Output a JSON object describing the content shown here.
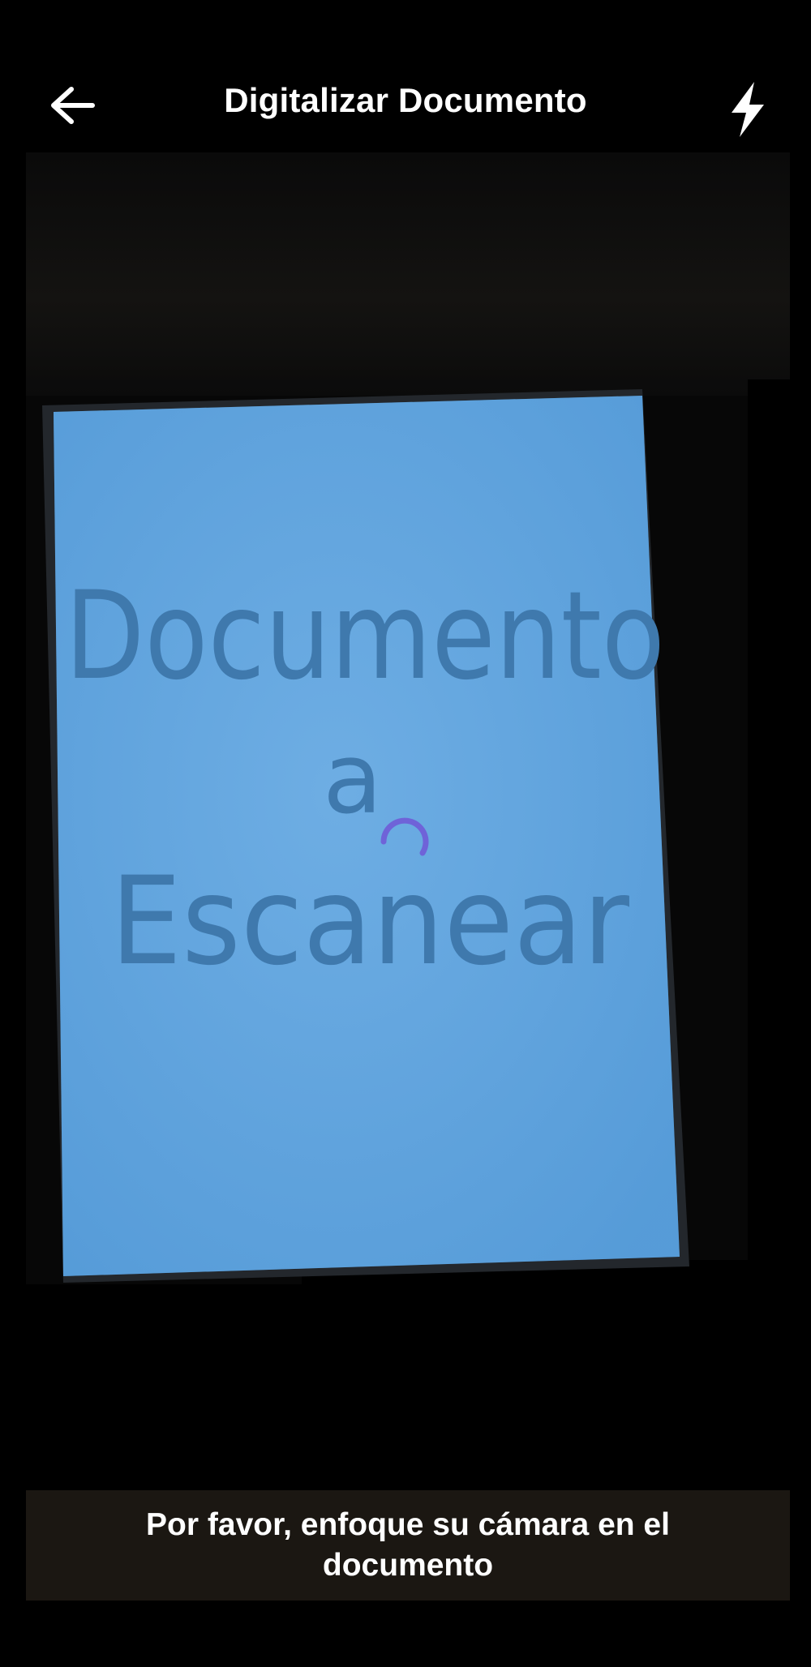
{
  "header": {
    "title": "Digitalizar Documento",
    "back_icon": "arrow-left-icon",
    "flash_icon": "flash-icon"
  },
  "camera": {
    "document_text_line1": "Documento",
    "document_text_line2": "a",
    "document_text_line3": "Escanear",
    "paper_color": "#5aa0dc",
    "spinner_color": "#6f63d8"
  },
  "footer": {
    "message": "Por favor, enfoque su cámara en el documento"
  }
}
